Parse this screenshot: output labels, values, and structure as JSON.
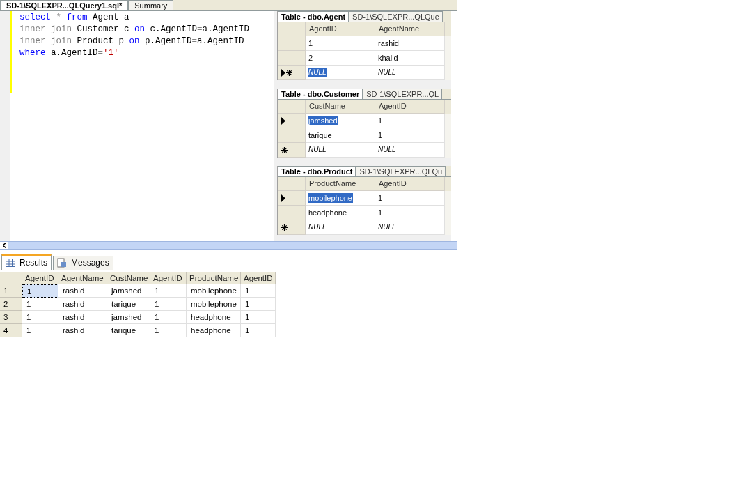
{
  "editor_tabs": [
    {
      "label": "SD-1\\SQLEXPR...QLQuery1.sql*",
      "selected": true
    },
    {
      "label": "Summary",
      "selected": false
    }
  ],
  "query": [
    [
      {
        "kind": "keyword",
        "text": "select"
      },
      {
        "kind": "operator",
        "text": " * "
      },
      {
        "kind": "keyword",
        "text": "from"
      },
      {
        "kind": "plain",
        "text": " Agent a"
      }
    ],
    [
      {
        "kind": "operator",
        "text": "inner join"
      },
      {
        "kind": "plain",
        "text": " Customer c "
      },
      {
        "kind": "keyword",
        "text": "on"
      },
      {
        "kind": "plain",
        "text": " c.AgentID"
      },
      {
        "kind": "operator",
        "text": "="
      },
      {
        "kind": "plain",
        "text": "a.AgentID"
      }
    ],
    [
      {
        "kind": "operator",
        "text": "inner join"
      },
      {
        "kind": "plain",
        "text": " Product p "
      },
      {
        "kind": "keyword",
        "text": "on"
      },
      {
        "kind": "plain",
        "text": " p.AgentID"
      },
      {
        "kind": "operator",
        "text": "="
      },
      {
        "kind": "plain",
        "text": "a.AgentID"
      }
    ],
    [
      {
        "kind": "keyword",
        "text": "where"
      },
      {
        "kind": "plain",
        "text": " a.AgentID"
      },
      {
        "kind": "operator",
        "text": "="
      },
      {
        "kind": "string",
        "text": "'1'"
      }
    ]
  ],
  "table_windows": [
    {
      "tabs": [
        {
          "label": "Table - dbo.Agent",
          "selected": true
        },
        {
          "label": "SD-1\\SQLEXPR...QLQue",
          "selected": false
        }
      ],
      "columns": [
        "AgentID",
        "AgentName"
      ],
      "rows": [
        {
          "current": false,
          "new": false,
          "cells": [
            {
              "text": "1",
              "is_null": false,
              "selected": false
            },
            {
              "text": "rashid",
              "is_null": false,
              "selected": false
            }
          ]
        },
        {
          "current": false,
          "new": false,
          "cells": [
            {
              "text": "2",
              "is_null": false,
              "selected": false
            },
            {
              "text": "khalid",
              "is_null": false,
              "selected": false
            }
          ]
        },
        {
          "current": true,
          "new": true,
          "cells": [
            {
              "text": "NULL",
              "is_null": true,
              "selected": true
            },
            {
              "text": "NULL",
              "is_null": true,
              "selected": false
            }
          ]
        }
      ]
    },
    {
      "tabs": [
        {
          "label": "Table - dbo.Customer",
          "selected": true
        },
        {
          "label": "SD-1\\SQLEXPR...QL",
          "selected": false
        }
      ],
      "columns": [
        "CustName",
        "AgentID"
      ],
      "rows": [
        {
          "current": true,
          "new": false,
          "cells": [
            {
              "text": "jamshed",
              "is_null": false,
              "selected": true
            },
            {
              "text": "1",
              "is_null": false,
              "selected": false
            }
          ]
        },
        {
          "current": false,
          "new": false,
          "cells": [
            {
              "text": "tarique",
              "is_null": false,
              "selected": false
            },
            {
              "text": "1",
              "is_null": false,
              "selected": false
            }
          ]
        },
        {
          "current": false,
          "new": true,
          "cells": [
            {
              "text": "NULL",
              "is_null": true,
              "selected": false
            },
            {
              "text": "NULL",
              "is_null": true,
              "selected": false
            }
          ]
        }
      ]
    },
    {
      "tabs": [
        {
          "label": "Table - dbo.Product",
          "selected": true
        },
        {
          "label": "SD-1\\SQLEXPR...QLQu",
          "selected": false
        }
      ],
      "columns": [
        "ProductName",
        "AgentID"
      ],
      "rows": [
        {
          "current": true,
          "new": false,
          "cells": [
            {
              "text": "mobilephone",
              "is_null": false,
              "selected": true
            },
            {
              "text": "1",
              "is_null": false,
              "selected": false
            }
          ]
        },
        {
          "current": false,
          "new": false,
          "cells": [
            {
              "text": "headphone",
              "is_null": false,
              "selected": false
            },
            {
              "text": "1",
              "is_null": false,
              "selected": false
            }
          ]
        },
        {
          "current": false,
          "new": true,
          "cells": [
            {
              "text": "NULL",
              "is_null": true,
              "selected": false
            },
            {
              "text": "NULL",
              "is_null": true,
              "selected": false
            }
          ]
        }
      ]
    }
  ],
  "result_tabs": [
    {
      "label": "Results",
      "kind": "grid",
      "selected": true
    },
    {
      "label": "Messages",
      "kind": "messages",
      "selected": false
    }
  ],
  "results": {
    "columns": [
      "AgentID",
      "AgentName",
      "CustName",
      "AgentID",
      "ProductName",
      "AgentID"
    ],
    "rows": [
      {
        "number": "1",
        "cells": [
          {
            "text": "1",
            "selected": true
          },
          {
            "text": "rashid",
            "selected": false
          },
          {
            "text": "jamshed",
            "selected": false
          },
          {
            "text": "1",
            "selected": false
          },
          {
            "text": "mobilephone",
            "selected": false
          },
          {
            "text": "1",
            "selected": false
          }
        ]
      },
      {
        "number": "2",
        "cells": [
          {
            "text": "1",
            "selected": false
          },
          {
            "text": "rashid",
            "selected": false
          },
          {
            "text": "tarique",
            "selected": false
          },
          {
            "text": "1",
            "selected": false
          },
          {
            "text": "mobilephone",
            "selected": false
          },
          {
            "text": "1",
            "selected": false
          }
        ]
      },
      {
        "number": "3",
        "cells": [
          {
            "text": "1",
            "selected": false
          },
          {
            "text": "rashid",
            "selected": false
          },
          {
            "text": "jamshed",
            "selected": false
          },
          {
            "text": "1",
            "selected": false
          },
          {
            "text": "headphone",
            "selected": false
          },
          {
            "text": "1",
            "selected": false
          }
        ]
      },
      {
        "number": "4",
        "cells": [
          {
            "text": "1",
            "selected": false
          },
          {
            "text": "rashid",
            "selected": false
          },
          {
            "text": "tarique",
            "selected": false
          },
          {
            "text": "1",
            "selected": false
          },
          {
            "text": "headphone",
            "selected": false
          },
          {
            "text": "1",
            "selected": false
          }
        ]
      }
    ]
  }
}
